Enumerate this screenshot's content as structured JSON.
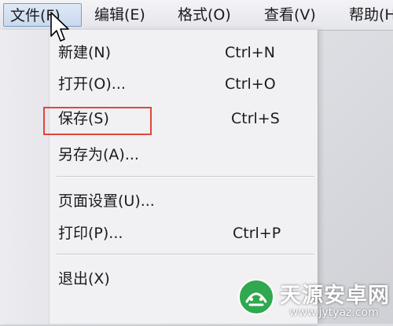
{
  "menubar": {
    "items": [
      "文件(F)",
      "编辑(E)",
      "格式(O)",
      "查看(V)",
      "帮助(H)"
    ]
  },
  "file_menu": {
    "items": [
      {
        "label": "新建(N)",
        "shortcut": "Ctrl+N"
      },
      {
        "label": "打开(O)...",
        "shortcut": "Ctrl+O"
      },
      {
        "label": "保存(S)",
        "shortcut": "Ctrl+S"
      },
      {
        "label": "另存为(A)...",
        "shortcut": ""
      },
      {
        "label": "页面设置(U)...",
        "shortcut": ""
      },
      {
        "label": "打印(P)...",
        "shortcut": "Ctrl+P"
      },
      {
        "label": "退出(X)",
        "shortcut": ""
      }
    ],
    "highlighted_item": "保存(S)"
  },
  "watermark": {
    "title": "天源安卓网",
    "url": "www.jytyaz.com"
  },
  "colors": {
    "highlight_border": "#e0463c",
    "active_menu_border": "#7f9cc4",
    "watermark_green": "#2fa84f"
  },
  "icons": [
    "mouse-pointer-icon",
    "watermark-logo-icon"
  ]
}
